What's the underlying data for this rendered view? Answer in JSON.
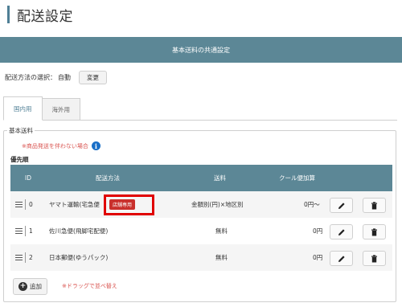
{
  "page": {
    "title": "配送設定"
  },
  "section": {
    "header": "基本送料の共通設定"
  },
  "method": {
    "label": "配送方法の選択：",
    "value": "自動",
    "change_label": "変更"
  },
  "tabs": [
    {
      "label": "国内用",
      "active": true
    },
    {
      "label": "海外用",
      "active": false
    }
  ],
  "basic": {
    "legend": "基本送料",
    "note": "※商品発送を伴わない場合",
    "priority_label": "優先順"
  },
  "table": {
    "headers": {
      "id": "ID",
      "method": "配送方法",
      "fee": "送料",
      "cool": "クール便加算"
    },
    "rows": [
      {
        "id": "0",
        "method": "ヤマト運輸(宅急便",
        "badge": "店舗専用",
        "fee": "金額別(円)×地区別",
        "cool": "0円〜"
      },
      {
        "id": "1",
        "method": "佐川急便(飛脚宅配便)",
        "fee": "無料",
        "cool": "0円"
      },
      {
        "id": "2",
        "method": "日本郵便(ゆうパック)",
        "fee": "無料",
        "cool": "0円"
      }
    ]
  },
  "footer": {
    "add_label": "追加",
    "drag_note": "※ドラッグで並べ替え"
  },
  "colors": {
    "header_bg": "#5c8796",
    "accent": "#4f7f95",
    "badge": "#c9302c",
    "note": "#d9534f",
    "highlight": "#e00000"
  }
}
